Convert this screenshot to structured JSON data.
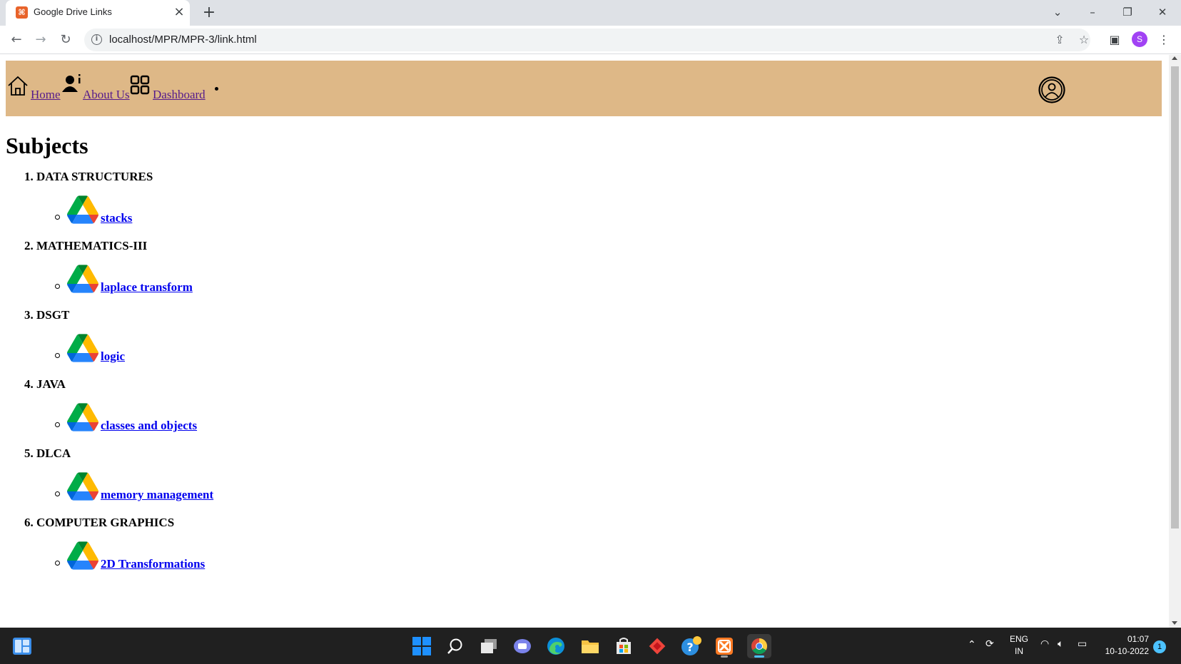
{
  "browser": {
    "tab_title": "Google Drive Links",
    "url": "localhost/MPR/MPR-3/link.html",
    "profile_initial": "S",
    "favicon_glyph": "⌘"
  },
  "nav": {
    "home": "Home",
    "about": "About Us",
    "dashboard": "Dashboard"
  },
  "page": {
    "title": "Subjects"
  },
  "subjects": [
    {
      "label": "1. DATA STRUCTURES",
      "link": "stacks"
    },
    {
      "label": "2. MATHEMATICS-III",
      "link": "laplace transform"
    },
    {
      "label": "3. DSGT",
      "link": "logic"
    },
    {
      "label": "4. JAVA",
      "link": "classes and objects"
    },
    {
      "label": "5. DLCA",
      "link": "memory management"
    },
    {
      "label": "6. COMPUTER GRAPHICS",
      "link": "2D Transformations"
    }
  ],
  "taskbar": {
    "lang_top": "ENG",
    "lang_bottom": "IN",
    "time": "01:07",
    "date": "10-10-2022",
    "notifications": "1"
  },
  "colors": {
    "navbar_bg": "#deb887",
    "link": "#0000ee",
    "visited_link": "#551a8b"
  }
}
